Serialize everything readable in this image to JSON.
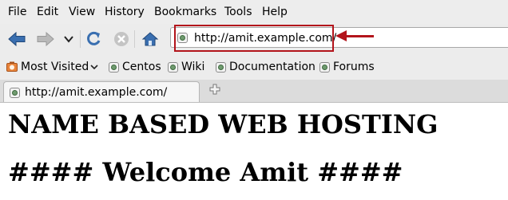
{
  "menubar": {
    "file": "File",
    "edit": "Edit",
    "view": "View",
    "history": "History",
    "bookmarks": "Bookmarks",
    "tools": "Tools",
    "help": "Help"
  },
  "navbar": {
    "url": "http://amit.example.com/",
    "icons": {
      "back": "back-arrow-icon",
      "forward": "forward-arrow-icon",
      "history_dropdown": "chevron-down-icon",
      "reload": "reload-icon",
      "stop": "stop-icon",
      "home": "home-icon"
    }
  },
  "bookmarks": {
    "most_visited": "Most Visited",
    "items": [
      "Centos",
      "Wiki",
      "Documentation",
      "Forums"
    ]
  },
  "tabbar": {
    "active_tab": "http://amit.example.com/"
  },
  "content": {
    "heading1": "NAME BASED WEB HOSTING",
    "heading2": "#### Welcome Amit ####"
  },
  "colors": {
    "annotation": "#b3141b",
    "toolbar": "#ececec",
    "nav_icon": "#3a6fb0"
  }
}
